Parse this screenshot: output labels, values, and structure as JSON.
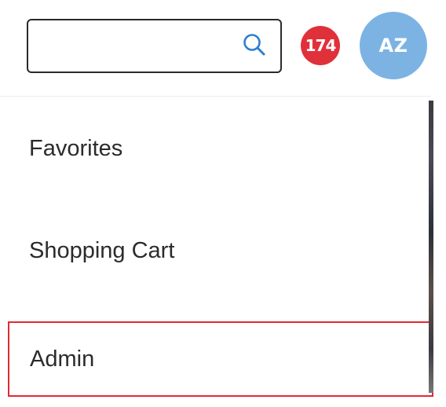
{
  "header": {
    "search": {
      "value": "",
      "placeholder": "",
      "icon": "search-icon"
    },
    "notifications": {
      "count": "174",
      "color": "#e0313a"
    },
    "avatar": {
      "initials": "AZ",
      "color": "#7cb3e3"
    }
  },
  "menu": {
    "items": [
      {
        "label": "Favorites"
      },
      {
        "label": "Shopping Cart"
      },
      {
        "label": "Admin",
        "highlighted": true,
        "highlight_color": "#e02a35"
      }
    ]
  }
}
